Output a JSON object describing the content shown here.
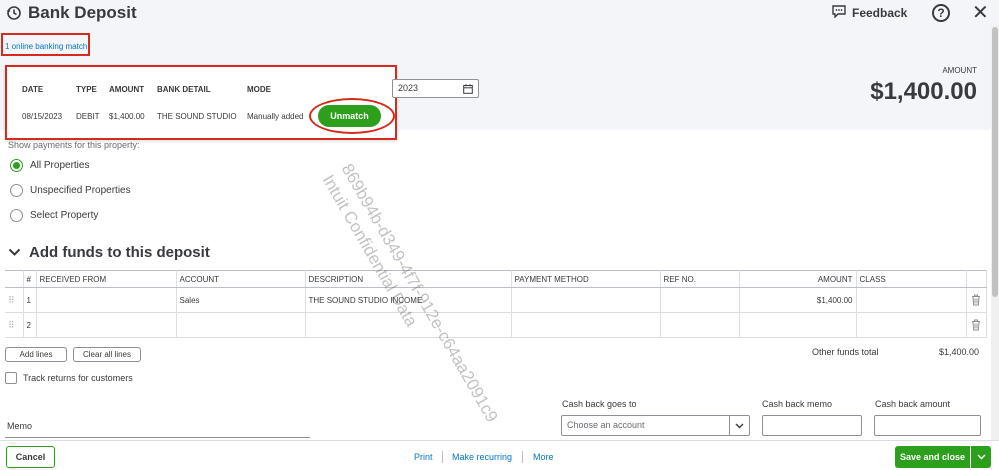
{
  "header": {
    "title": "Bank Deposit",
    "feedback_label": "Feedback",
    "help_glyph": "?",
    "close_glyph": "✕"
  },
  "banking_match": {
    "link_text": "1 online banking match",
    "headers": [
      "DATE",
      "TYPE",
      "AMOUNT",
      "BANK DETAIL",
      "MODE"
    ],
    "row": {
      "date": "08/15/2023",
      "type": "DEBIT",
      "amount": "$1,400.00",
      "bank_detail": "THE SOUND STUDIO",
      "mode": "Manually added"
    },
    "unmatch_label": "Unmatch"
  },
  "date_field": {
    "value": "2023"
  },
  "amount": {
    "label": "AMOUNT",
    "value": "$1,400.00"
  },
  "properties": {
    "prompt": "Show payments for this property:",
    "options": [
      {
        "label": "All Properties",
        "checked": true
      },
      {
        "label": "Unspecified Properties",
        "checked": false
      },
      {
        "label": "Select Property",
        "checked": false
      }
    ]
  },
  "funds": {
    "title": "Add funds to this deposit",
    "columns": [
      "#",
      "RECEIVED FROM",
      "ACCOUNT",
      "DESCRIPTION",
      "PAYMENT METHOD",
      "REF NO.",
      "AMOUNT",
      "CLASS"
    ],
    "rows": [
      {
        "num": "1",
        "received_from": "",
        "account": "Sales",
        "description": "THE SOUND STUDIO INCOME",
        "payment_method": "",
        "ref_no": "",
        "amount": "$1,400.00",
        "class": ""
      },
      {
        "num": "2",
        "received_from": "",
        "account": "",
        "description": "",
        "payment_method": "",
        "ref_no": "",
        "amount": "",
        "class": ""
      }
    ],
    "add_lines_label": "Add lines",
    "clear_lines_label": "Clear all lines",
    "other_funds_label": "Other funds total",
    "other_funds_value": "$1,400.00",
    "track_returns_label": "Track returns for customers"
  },
  "cash_back": {
    "goes_to_label": "Cash back goes to",
    "goes_to_placeholder": "Choose an account",
    "memo_label": "Cash back memo",
    "amount_label": "Cash back amount"
  },
  "memo": {
    "label": "Memo"
  },
  "footer": {
    "cancel_label": "Cancel",
    "print_label": "Print",
    "recurring_label": "Make recurring",
    "more_label": "More",
    "save_label": "Save and close"
  },
  "watermark": {
    "line1": "869b94b-d349-4f7f-912e-c64aa2091c9",
    "line2": "Intuit Confidential Data"
  },
  "colors": {
    "accent_green": "#2ca01c",
    "link_blue": "#0077c5",
    "highlight_red": "#d52b1e"
  }
}
